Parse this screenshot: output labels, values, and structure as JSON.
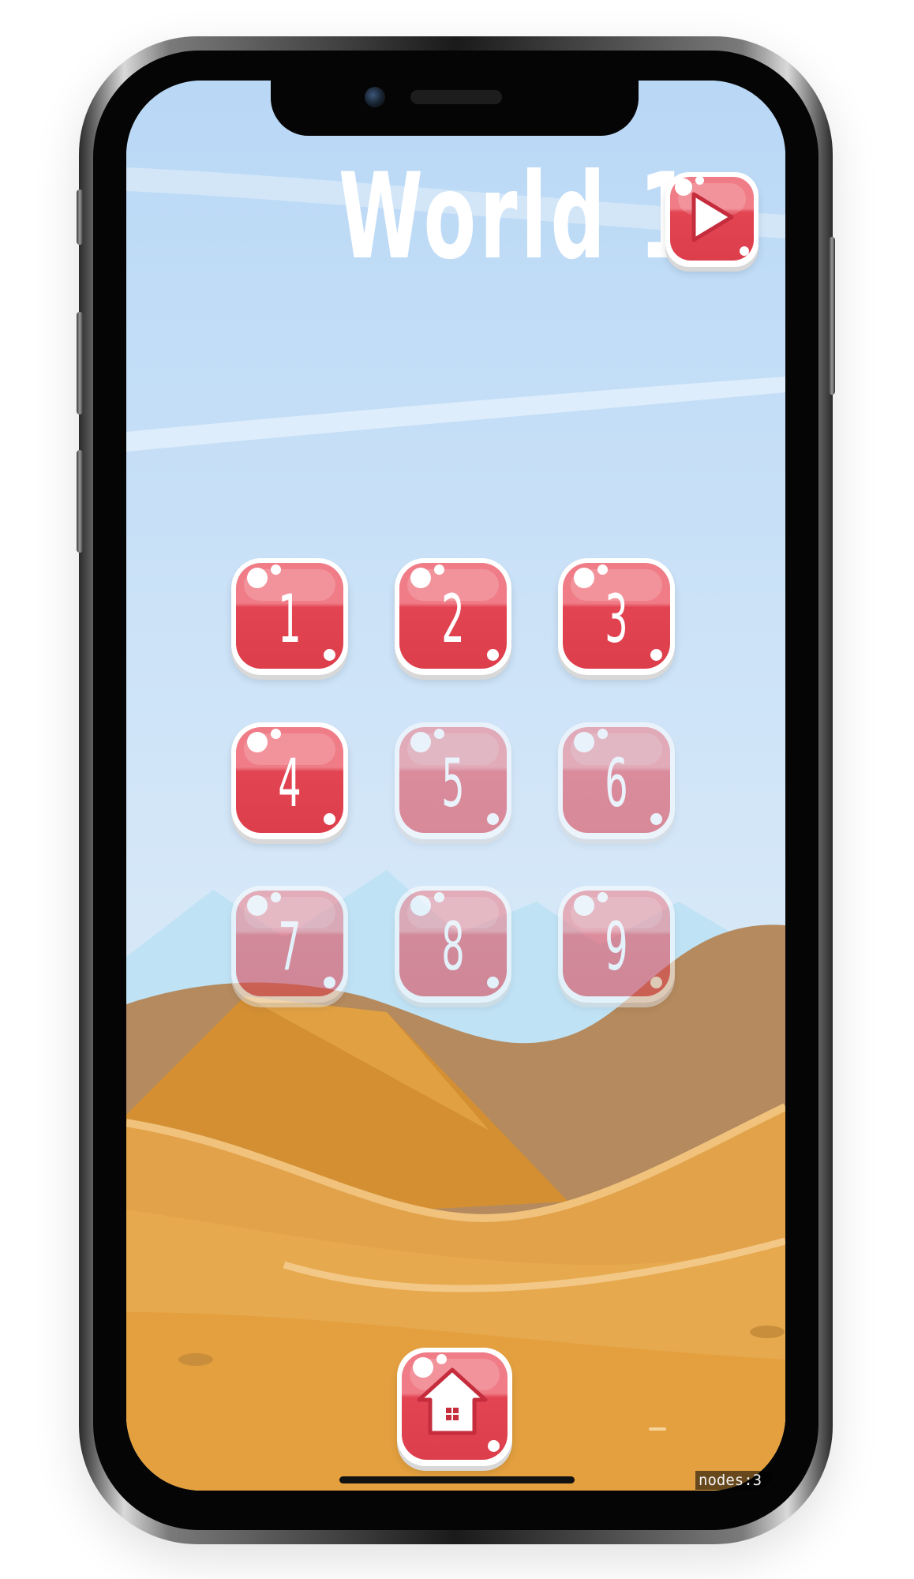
{
  "screen": {
    "title": "World 1",
    "levels": [
      {
        "label": "1",
        "state": "unlocked"
      },
      {
        "label": "2",
        "state": "unlocked"
      },
      {
        "label": "3",
        "state": "unlocked"
      },
      {
        "label": "4",
        "state": "unlocked"
      },
      {
        "label": "5",
        "state": "locked"
      },
      {
        "label": "6",
        "state": "locked"
      },
      {
        "label": "7",
        "state": "locked"
      },
      {
        "label": "8",
        "state": "locked"
      },
      {
        "label": "9",
        "state": "locked"
      }
    ],
    "play_button_icon": "play-icon",
    "home_button_icon": "home-icon",
    "debug_overlay": "nodes:3"
  },
  "colors": {
    "sky_top": "#b9d8f6",
    "sky_bottom": "#d6e8f8",
    "jelly_red": "#e24452",
    "jelly_light": "#ef7c86",
    "sand_light": "#e9a94c",
    "sand_mid": "#dc9a36",
    "dune_brown": "#b48a5e"
  }
}
